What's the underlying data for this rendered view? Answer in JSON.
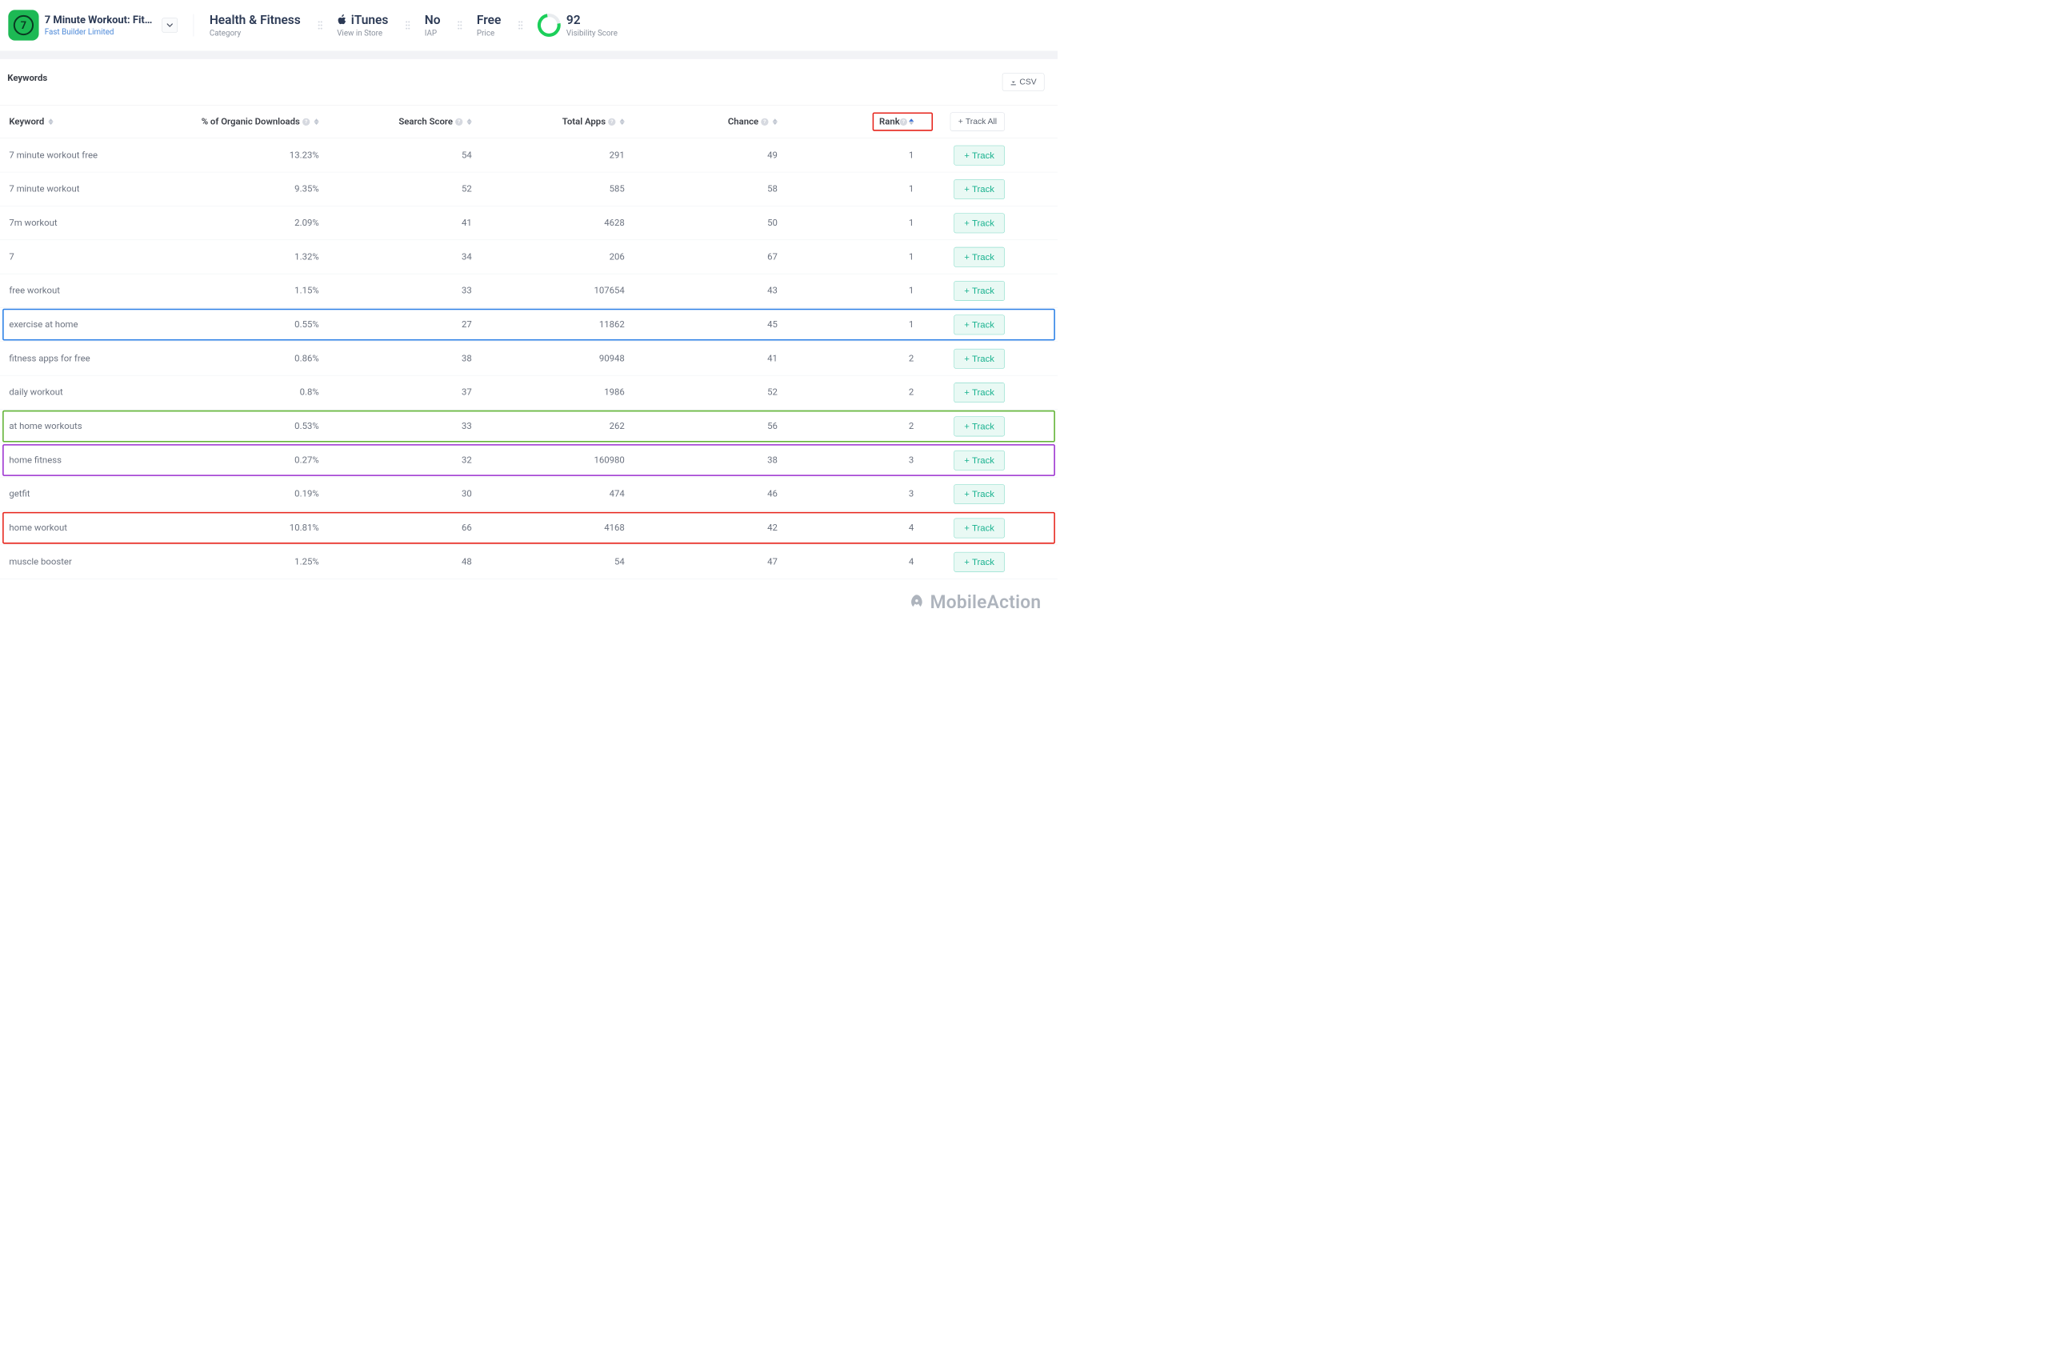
{
  "header": {
    "appTitle": "7 Minute Workout: Fitn...",
    "publisher": "Fast Builder Limited",
    "category": {
      "value": "Health & Fitness",
      "label": "Category"
    },
    "store": {
      "value": "iTunes",
      "label": "View in Store"
    },
    "iap": {
      "value": "No",
      "label": "IAP"
    },
    "price": {
      "value": "Free",
      "label": "Price"
    },
    "visibility": {
      "value": "92",
      "label": "Visibility Score"
    }
  },
  "section": {
    "title": "Keywords",
    "csv": "CSV"
  },
  "columns": {
    "keyword": "Keyword",
    "organic": "% of Organic Downloads",
    "search": "Search Score",
    "totalApps": "Total Apps",
    "chance": "Chance",
    "rank": "Rank",
    "trackAll": "Track All",
    "track": "Track"
  },
  "rows": [
    {
      "keyword": "7 minute workout free",
      "organic": "13.23%",
      "search": "54",
      "totalApps": "291",
      "chance": "49",
      "rank": "1",
      "highlight": ""
    },
    {
      "keyword": "7 minute workout",
      "organic": "9.35%",
      "search": "52",
      "totalApps": "585",
      "chance": "58",
      "rank": "1",
      "highlight": ""
    },
    {
      "keyword": "7m workout",
      "organic": "2.09%",
      "search": "41",
      "totalApps": "4628",
      "chance": "50",
      "rank": "1",
      "highlight": ""
    },
    {
      "keyword": "7",
      "organic": "1.32%",
      "search": "34",
      "totalApps": "206",
      "chance": "67",
      "rank": "1",
      "highlight": ""
    },
    {
      "keyword": "free workout",
      "organic": "1.15%",
      "search": "33",
      "totalApps": "107654",
      "chance": "43",
      "rank": "1",
      "highlight": ""
    },
    {
      "keyword": "exercise at home",
      "organic": "0.55%",
      "search": "27",
      "totalApps": "11862",
      "chance": "45",
      "rank": "1",
      "highlight": "#2a7fe6"
    },
    {
      "keyword": "fitness apps for free",
      "organic": "0.86%",
      "search": "38",
      "totalApps": "90948",
      "chance": "41",
      "rank": "2",
      "highlight": ""
    },
    {
      "keyword": "daily workout",
      "organic": "0.8%",
      "search": "37",
      "totalApps": "1986",
      "chance": "52",
      "rank": "2",
      "highlight": ""
    },
    {
      "keyword": "at home workouts",
      "organic": "0.53%",
      "search": "33",
      "totalApps": "262",
      "chance": "56",
      "rank": "2",
      "highlight": "#5fb232"
    },
    {
      "keyword": "home fitness",
      "organic": "0.27%",
      "search": "32",
      "totalApps": "160980",
      "chance": "38",
      "rank": "3",
      "highlight": "#9b2fcf"
    },
    {
      "keyword": "getfit",
      "organic": "0.19%",
      "search": "30",
      "totalApps": "474",
      "chance": "46",
      "rank": "3",
      "highlight": ""
    },
    {
      "keyword": "home workout",
      "organic": "10.81%",
      "search": "66",
      "totalApps": "4168",
      "chance": "42",
      "rank": "4",
      "highlight": "#e6231a"
    },
    {
      "keyword": "muscle booster",
      "organic": "1.25%",
      "search": "48",
      "totalApps": "54",
      "chance": "47",
      "rank": "4",
      "highlight": ""
    }
  ],
  "footer": {
    "brand": "MobileAction"
  }
}
